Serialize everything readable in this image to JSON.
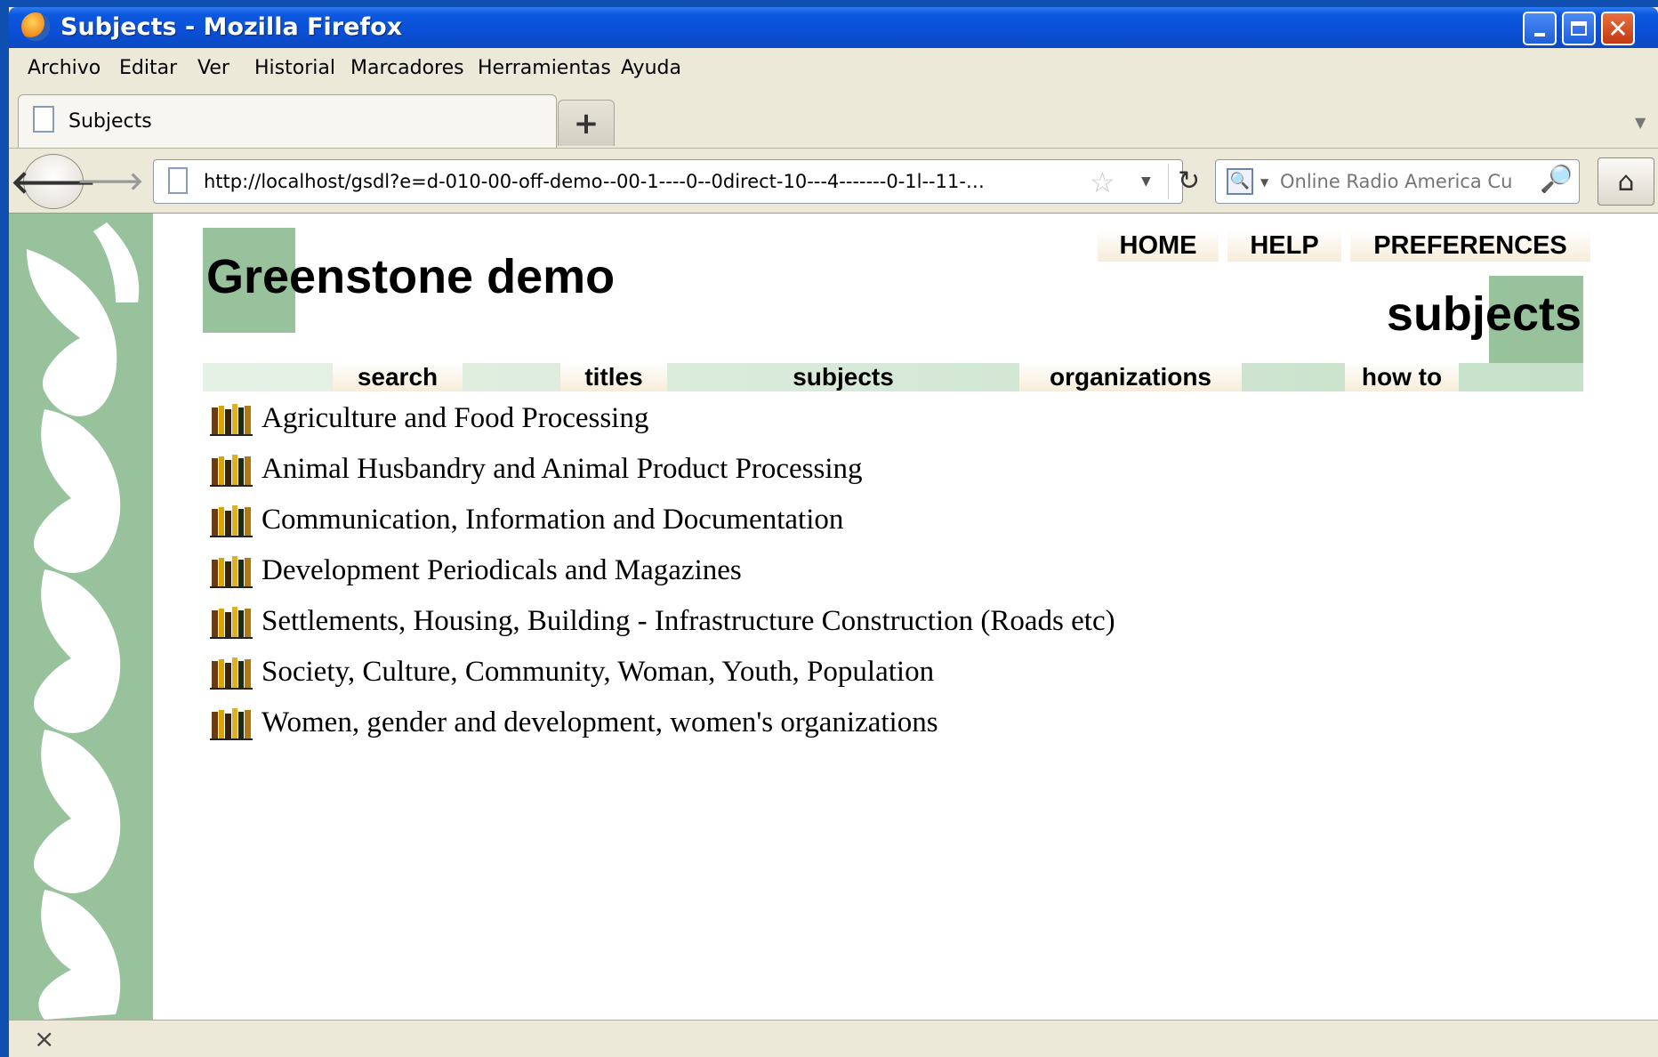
{
  "window": {
    "title": "Subjects - Mozilla Firefox"
  },
  "menu": [
    "Archivo",
    "Editar",
    "Ver",
    "Historial",
    "Marcadores",
    "Herramientas",
    "Ayuda"
  ],
  "tab": {
    "label": "Subjects",
    "new_tab": "+"
  },
  "nav": {
    "url": "http://localhost/gsdl?e=d-010-00-off-demo--00-1----0--0direct-10---4-------0-1l--11-…",
    "search_placeholder": "Online Radio America Cu"
  },
  "page": {
    "collection_title": "Greenstone demo",
    "top_links": [
      "HOME",
      "HELP",
      "PREFERENCES"
    ],
    "page_heading": "subjects",
    "nav_tabs": [
      "search",
      "titles",
      "subjects",
      "organizations",
      "how to"
    ],
    "subjects": [
      "Agriculture and Food Processing",
      "Animal Husbandry and Animal Product Processing",
      "Communication, Information and Documentation",
      "Development Periodicals and Magazines",
      "Settlements, Housing, Building - Infrastructure Construction (Roads etc)",
      "Society, Culture, Community, Woman, Youth, Population",
      "Women, gender and development, women's organizations"
    ]
  },
  "status": {
    "close_symbol": "×"
  },
  "colors": {
    "accent_green": "#97c29b",
    "titlebar_blue": "#0a4fd6"
  }
}
